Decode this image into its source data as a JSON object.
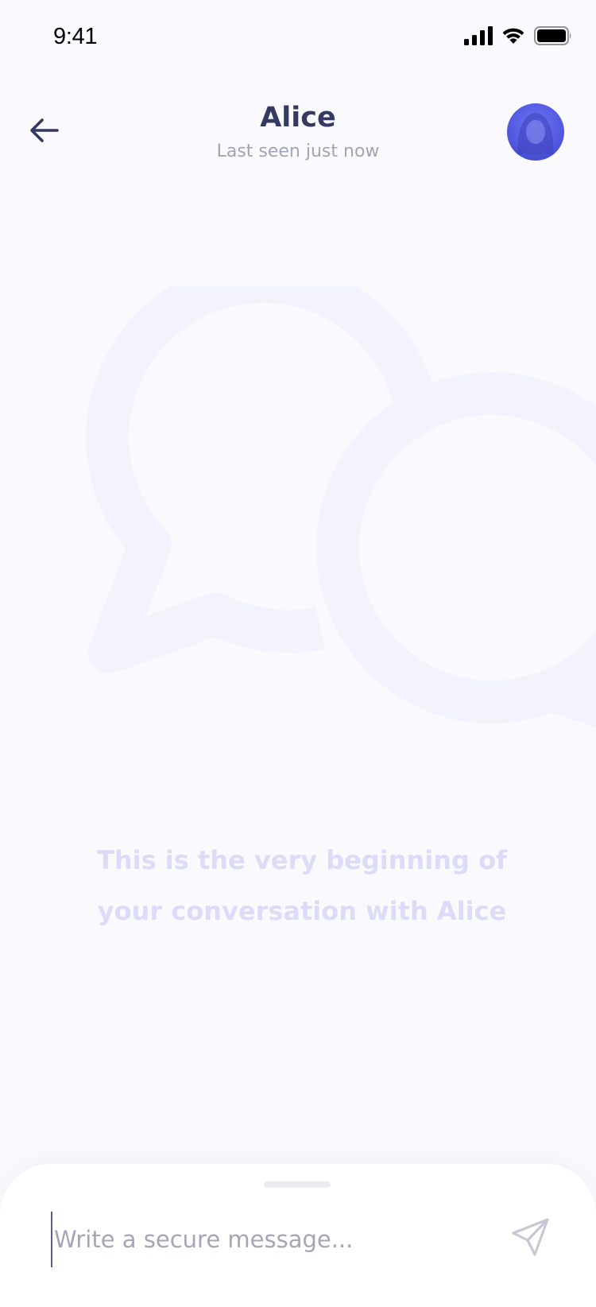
{
  "status_bar": {
    "time": "9:41",
    "icons": [
      "cellular-signal-icon",
      "wifi-icon",
      "battery-icon"
    ]
  },
  "header": {
    "contact_name": "Alice",
    "last_seen": "Last seen just now",
    "back_icon": "arrow-left-icon",
    "avatar": "contact-avatar"
  },
  "empty_state": {
    "message": "This is the very beginning of your conversation with Alice",
    "illustration": "chat-bubbles-icon"
  },
  "composer": {
    "placeholder": "Write a secure message...",
    "value": "",
    "send_icon": "send-paper-plane-icon"
  },
  "colors": {
    "background": "#f9f9fe",
    "title": "#363960",
    "subtitle": "#a2a3b5",
    "empty_text": "#dcdcf9",
    "avatar": "#5960e6"
  }
}
